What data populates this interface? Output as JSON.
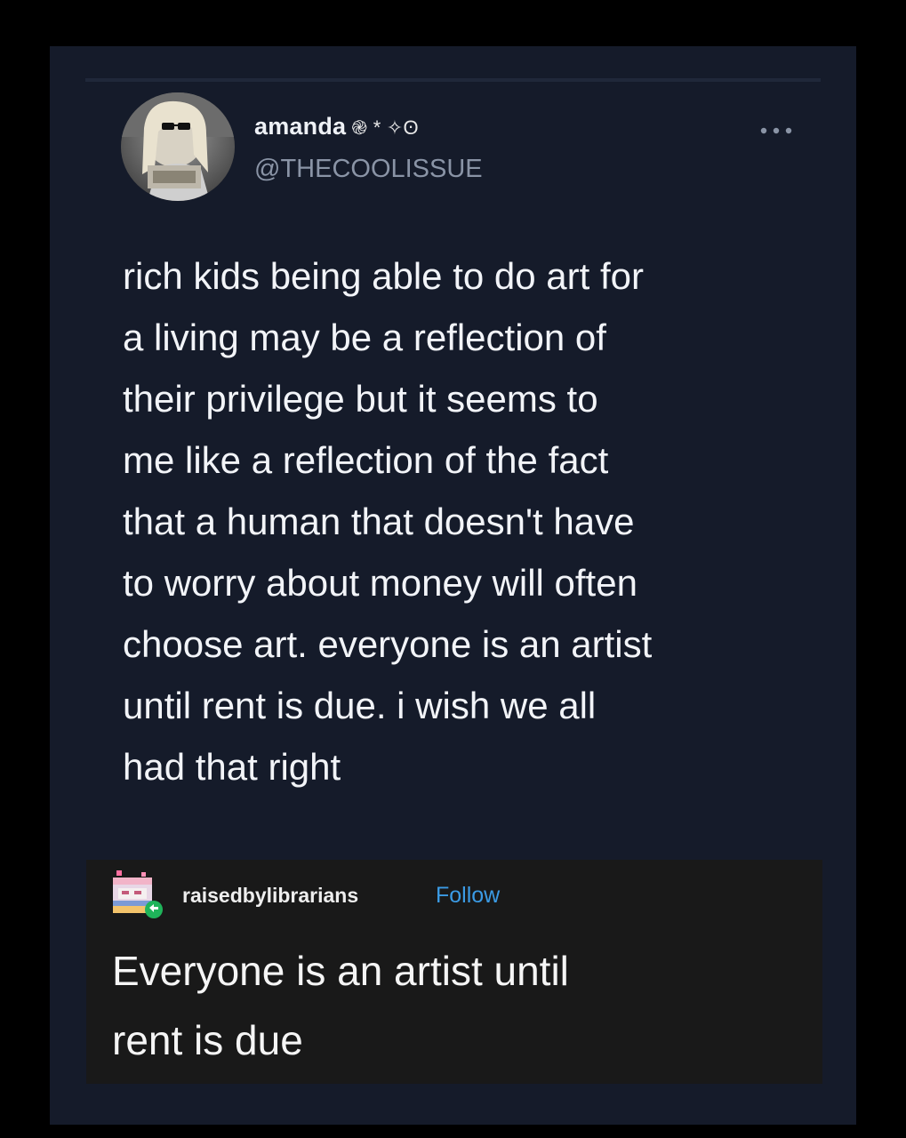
{
  "tweet": {
    "author": {
      "display_name": "amanda",
      "name_emoji": "֎ * ✧ʘ",
      "handle": "@THECOOLISSUE"
    },
    "more_icon": "more-horizontal-icon",
    "text_lines": [
      "rich kids being able to do art for",
      "a living may be a reflection of",
      "their privilege but it seems to",
      "me like a reflection of the fact",
      "that a human that doesn't have",
      "to worry about money will often",
      "choose art. everyone is an artist",
      "until rent is due. i wish we all",
      "had that right"
    ]
  },
  "reblog": {
    "username": "raisedbylibrarians",
    "follow_label": "Follow",
    "text_lines": [
      "Everyone is an artist until",
      "rent is due"
    ]
  },
  "colors": {
    "page_background": "#000000",
    "card_background": "#151b2a",
    "reblog_background": "#191919",
    "follow_link": "#3b9be5",
    "handle_text": "#8a94a6"
  }
}
